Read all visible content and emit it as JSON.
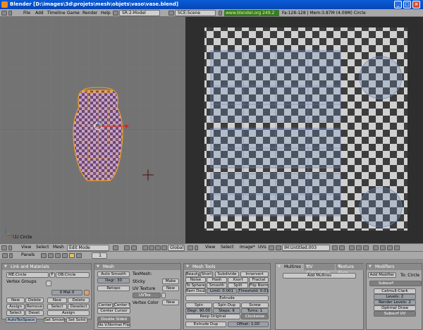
{
  "window": {
    "title": "Blender [D:\\images\\3d\\projets\\mesh\\objets\\vaso\\vase.blend]",
    "minimize": "_",
    "maximize": "□",
    "close": "×"
  },
  "menubar": {
    "items": [
      "File",
      "Add",
      "Timeline",
      "Game",
      "Render",
      "Help"
    ],
    "screen": "SR:2-Model",
    "scene": "SCE:Scene",
    "url": "www.blender.org 249.2",
    "stats": "Fa:128-128 | Mem:3.87M (4.09M) Circle"
  },
  "view3d": {
    "object_label": "(1) Circle",
    "header": {
      "view": "View",
      "select": "Select",
      "mesh": "Mesh",
      "mode": "Edit Mode",
      "orientation": "Global"
    }
  },
  "uv": {
    "header": {
      "view": "View",
      "select": "Select",
      "image": "Image*",
      "uvs": "UVs",
      "image_name": "IM:Untitled.003"
    }
  },
  "buttons_header": {
    "panels": "Panels",
    "frame": "1"
  },
  "link_materials": {
    "title": "Link and Materials",
    "me": "ME:Circle",
    "f": "F",
    "ob": "OB:Circle",
    "vertex_groups": "Vertex Groups",
    "mat": "0 Mat 0",
    "left_btns": [
      "New",
      "Delete",
      "Assign",
      "Remove",
      "Select",
      "Desel."
    ],
    "right_btns": [
      "New",
      "Delete",
      "Select",
      "Deselect",
      "Assign"
    ],
    "autotex": "AutoTexSpace",
    "set_smooth": "Set Smooth",
    "set_solid": "Set Solid"
  },
  "mesh": {
    "title": "Mesh",
    "auto_smooth": "Auto Smooth",
    "degr": "Degr: 30",
    "retopo": "Retopo",
    "texmesh": "TexMesh:",
    "sticky": "Sticky",
    "make": "Make",
    "uv_texture": "UV Texture",
    "new": "New",
    "uvtex": "UVTex",
    "vertex_color": "Vertex Color",
    "new2": "New",
    "center": "Center",
    "center_new": "Center New",
    "center_cursor": "Center Cursor",
    "double_sided": "Double Sided",
    "no_vnormal_flip": "No V.Normal Flip"
  },
  "mesh_tools": {
    "title": "Mesh Tools",
    "beauty": "Beauty",
    "short": "Short",
    "subdivide": "Subdivide",
    "innervert": "Innervert",
    "noise": "Noise",
    "hash": "Hash",
    "xsort": "Xsort",
    "fractal": "Fractal",
    "to_sphere": "To Sphere",
    "smooth": "Smooth",
    "split": "Split",
    "flip_normals": "Flip Normals",
    "rem_double": "Rem Double",
    "limit": "Limit: 0.001",
    "threshold": "Threshold: 0.010",
    "extrude": "Extrude",
    "spin": "Spin",
    "spin_dup": "Spin Dup",
    "screw": "Screw",
    "degr": "Degr: 90.00",
    "steps": "Steps: 9",
    "turns": "Turns: 1",
    "keep_original": "Keep Original",
    "clockwise": "Clockwise",
    "extrude_dup": "Extrude Dup",
    "offset": "Offset: 1.00"
  },
  "multires": {
    "tabs": [
      "Multires",
      "UV Calculation",
      "Texture Face"
    ],
    "add": "Add Multires"
  },
  "modifiers": {
    "title": "Modifiers",
    "add_modifier": "Add Modifier",
    "to": "To: Circle",
    "name": "Subsurf",
    "type": "Catmull-Clark",
    "levels": "Levels: 2",
    "render_levels": "Render Levels: 2",
    "optimal_draw": "Optimal Draw",
    "subsurf_uv": "Subsurf UV"
  },
  "colors": {
    "vase_wire": "#f0a020",
    "uv_select": "#8aa8d8",
    "url_green": "#3a7a2a"
  }
}
